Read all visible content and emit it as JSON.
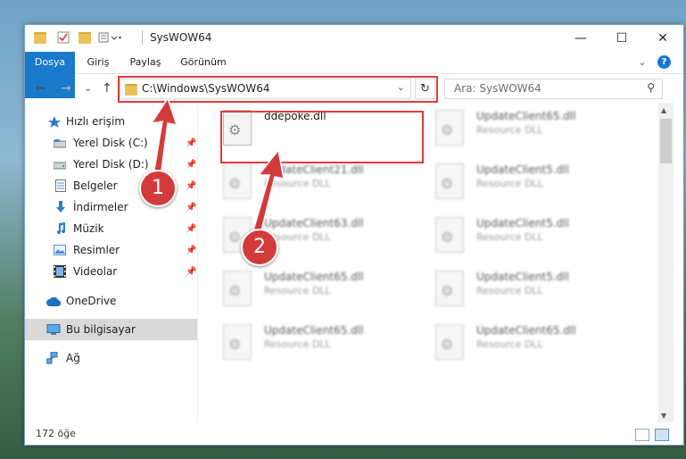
{
  "window": {
    "title": "SysWOW64",
    "controls": {
      "minimize": "—",
      "maximize": "☐",
      "close": "✕"
    }
  },
  "ribbon": {
    "tabs": [
      {
        "label": "Dosya"
      },
      {
        "label": "Giriş"
      },
      {
        "label": "Paylaş"
      },
      {
        "label": "Görünüm"
      }
    ],
    "expand": "⌄",
    "help": "?"
  },
  "nav": {
    "back": "←",
    "forward": "→",
    "recent": "⌄",
    "up": "↑",
    "address_path": "C:\\Windows\\SysWOW64",
    "address_chevron": "⌄",
    "refresh": "↻",
    "search_placeholder": "Ara: SysWOW64",
    "search_icon": "⚲"
  },
  "sidebar": {
    "items": [
      {
        "label": "Hızlı erişim",
        "icon": "star-icon",
        "pinned": false
      },
      {
        "label": "Yerel Disk (C:)",
        "icon": "drive-icon",
        "pinned": true
      },
      {
        "label": "Yerel Disk (D:)",
        "icon": "drive-icon",
        "pinned": true
      },
      {
        "label": "Belgeler",
        "icon": "documents-icon",
        "pinned": true
      },
      {
        "label": "İndirmeler",
        "icon": "download-icon",
        "pinned": true
      },
      {
        "label": "Müzik",
        "icon": "music-icon",
        "pinned": true
      },
      {
        "label": "Resimler",
        "icon": "pictures-icon",
        "pinned": true
      },
      {
        "label": "Videolar",
        "icon": "video-icon",
        "pinned": true
      },
      {
        "label": "OneDrive",
        "icon": "cloud-icon",
        "pinned": false
      },
      {
        "label": "Bu bilgisayar",
        "icon": "computer-icon",
        "pinned": false,
        "selected": true
      },
      {
        "label": "Ağ",
        "icon": "network-icon",
        "pinned": false
      }
    ],
    "pin_glyph": "📌"
  },
  "files": [
    {
      "name": "ddepoke.dll",
      "type": "",
      "highlight": true
    },
    {
      "name": "UpdateClient65.dll",
      "type": "Resource DLL"
    },
    {
      "name": "UpdateClient21.dll",
      "type": "Resource DLL"
    },
    {
      "name": "UpdateClient5.dll",
      "type": "Resource DLL"
    },
    {
      "name": "UpdateClient63.dll",
      "type": "Resource DLL"
    },
    {
      "name": "UpdateClient5.dll",
      "type": "Resource DLL"
    },
    {
      "name": "UpdateClient65.dll",
      "type": "Resource DLL"
    },
    {
      "name": "UpdateClient5.dll",
      "type": "Resource DLL"
    },
    {
      "name": "UpdateClient65.dll",
      "type": "Resource DLL"
    },
    {
      "name": "UpdateClient65.dll",
      "type": "Resource DLL"
    }
  ],
  "status": {
    "item_count": "172 öğe"
  },
  "callouts": [
    {
      "label": "1"
    },
    {
      "label": "2"
    }
  ],
  "colors": {
    "accent": "#1979ca",
    "highlight": "#e53a3a",
    "callout": "#d33b3b"
  }
}
